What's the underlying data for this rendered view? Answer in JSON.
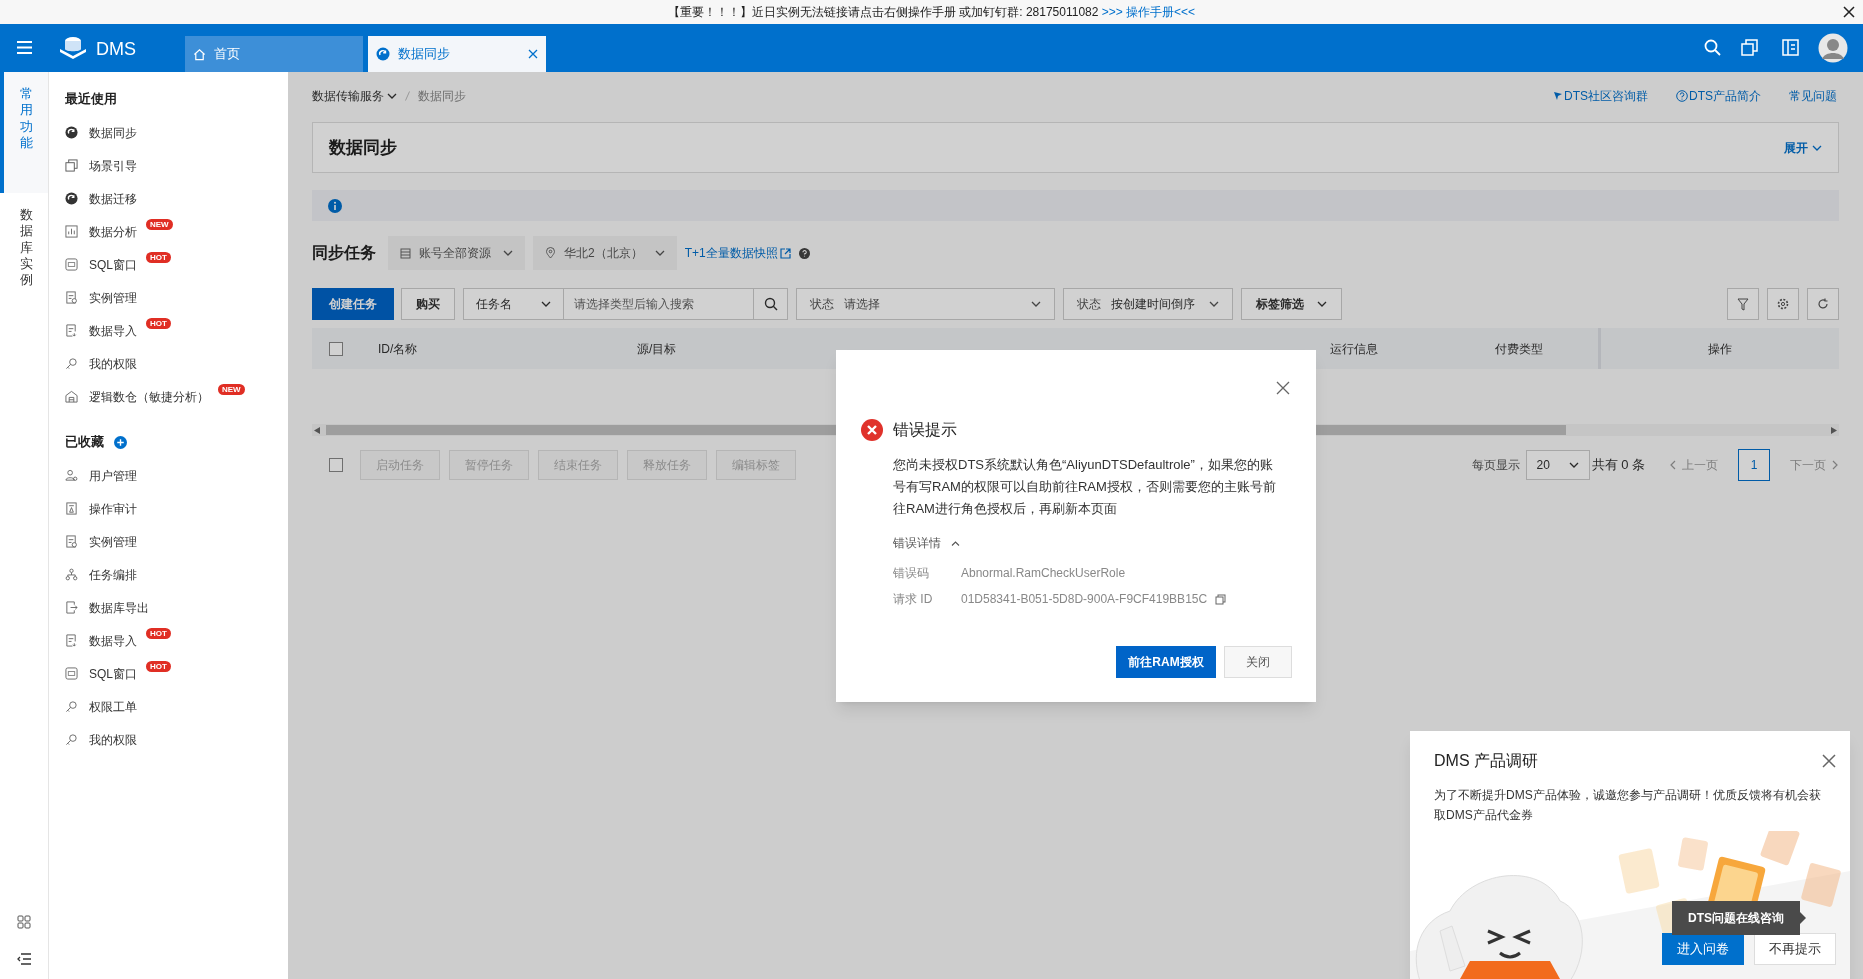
{
  "notice": {
    "text": "【重要！！！】近日实例无法链接请点击右侧操作手册 或加钉钉群: 28175011082",
    "link": ">>> 操作手册<<<"
  },
  "header": {
    "logo": "DMS",
    "tabs": [
      {
        "label": "首页",
        "kind": "home",
        "selected": false,
        "closable": false
      },
      {
        "label": "数据同步",
        "kind": "sync",
        "selected": true,
        "closable": true
      }
    ]
  },
  "rail": [
    {
      "label": "常用功能",
      "selected": true
    },
    {
      "label": "数据库实例",
      "selected": false
    }
  ],
  "sidebar": {
    "sections": [
      {
        "title": "最近使用",
        "add_button": false,
        "items": [
          {
            "label": "数据同步",
            "kind": "sync"
          },
          {
            "label": "场景引导",
            "kind": "guide"
          },
          {
            "label": "数据迁移",
            "kind": "sync"
          },
          {
            "label": "数据分析",
            "kind": "analysis",
            "badge": "NEW"
          },
          {
            "label": "SQL窗口",
            "kind": "sql",
            "badge": "HOT"
          },
          {
            "label": "实例管理",
            "kind": "instance"
          },
          {
            "label": "数据导入",
            "kind": "import",
            "badge": "HOT"
          },
          {
            "label": "我的权限",
            "kind": "permission"
          },
          {
            "label": "逻辑数仓（敏捷分析）",
            "kind": "warehouse",
            "badge": "NEW"
          }
        ]
      },
      {
        "title": "已收藏",
        "add_button": true,
        "items": [
          {
            "label": "用户管理",
            "kind": "user"
          },
          {
            "label": "操作审计",
            "kind": "audit"
          },
          {
            "label": "实例管理",
            "kind": "instance"
          },
          {
            "label": "任务编排",
            "kind": "flow"
          },
          {
            "label": "数据库导出",
            "kind": "export"
          },
          {
            "label": "数据导入",
            "kind": "import",
            "badge": "HOT"
          },
          {
            "label": "SQL窗口",
            "kind": "sql",
            "badge": "HOT"
          },
          {
            "label": "权限工单",
            "kind": "permission"
          },
          {
            "label": "我的权限",
            "kind": "permission"
          }
        ]
      }
    ]
  },
  "breadcrumb": [
    {
      "label": "数据传输服务",
      "dropdown": true
    },
    {
      "label": "数据同步",
      "dropdown": false
    }
  ],
  "help_links": [
    {
      "label": "DTS社区咨询群",
      "kind": "group"
    },
    {
      "label": "DTS产品简介",
      "kind": "info"
    },
    {
      "label": "常见问题",
      "kind": "plain"
    }
  ],
  "page_header": {
    "title": "数据同步",
    "expand_label": "展开"
  },
  "task_section": {
    "title": "同步任务",
    "filters": [
      {
        "label": "账号全部资源",
        "kind": "resource"
      },
      {
        "label": "华北2（北京）",
        "kind": "region"
      }
    ],
    "snapshot_link": "T+1全量数据快照"
  },
  "toolbar": {
    "create_button": "创建任务",
    "buy_button": "购买",
    "search_type": "任务名",
    "search_placeholder": "请选择类型后输入搜索",
    "status_filter": {
      "label": "状态",
      "value": "请选择"
    },
    "sort_filter": {
      "label": "状态",
      "value": "按创建时间倒序"
    },
    "tag_filter": "标签筛选"
  },
  "table": {
    "all_checked": false,
    "columns": [
      "ID/名称",
      "源/目标",
      "运行信息",
      "付费类型",
      "操作"
    ]
  },
  "bulk_actions": {
    "checked": false,
    "buttons": [
      {
        "label": "启动任务",
        "disabled": true
      },
      {
        "label": "暂停任务",
        "disabled": true
      },
      {
        "label": "结束任务",
        "disabled": true
      },
      {
        "label": "释放任务",
        "disabled": true
      },
      {
        "label": "编辑标签",
        "disabled": true
      }
    ]
  },
  "pagination": {
    "page_size_label": "每页显示",
    "page_size": "20",
    "total": "共有 0 条",
    "prev": "上一页",
    "next": "下一页",
    "pages": [
      {
        "label": "1",
        "selected": true
      }
    ]
  },
  "error_dialog": {
    "title": "错误提示",
    "message": "您尚未授权DTS系统默认角色“AliyunDTSDefaultrole”，如果您的账号有写RAM的权限可以自助前往RAM授权，否则需要您的主账号前往RAM进行角色授权后，再刷新本页面",
    "details_label": "错误详情",
    "details_expanded": true,
    "details": [
      {
        "label": "错误码",
        "value": "Abnormal.RamCheckUserRole",
        "copyable": false
      },
      {
        "label": "请求 ID",
        "value": "01D58341-B051-5D8D-900A-F9CF419BB15C",
        "copyable": true
      }
    ],
    "buttons": [
      {
        "label": "前往RAM授权",
        "kind": "primary"
      },
      {
        "label": "关闭",
        "kind": "secondary"
      }
    ]
  },
  "survey": {
    "title": "DMS 产品调研",
    "text": "为了不断提升DMS产品体验，诚邀您参与产品调研！优质反馈将有机会获取DMS产品代金券",
    "buttons": [
      {
        "label": "进入问卷",
        "kind": "primary"
      },
      {
        "label": "不再提示",
        "kind": "secondary"
      }
    ]
  },
  "tooltip": {
    "text": "DTS问题在线咨询"
  }
}
